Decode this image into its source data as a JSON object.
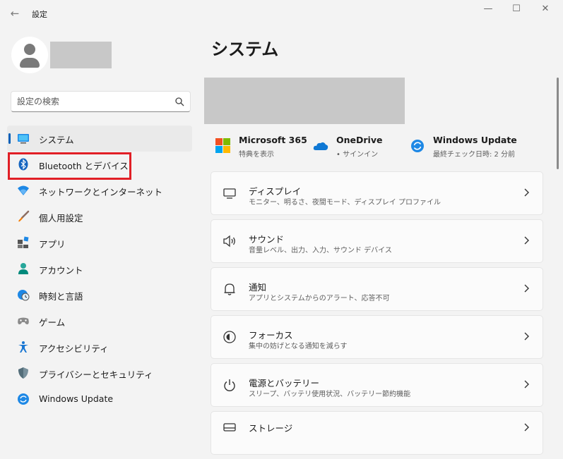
{
  "app": {
    "title": "設定"
  },
  "window_controls": {
    "minimize": "—",
    "maximize": "☐",
    "close": "✕"
  },
  "search": {
    "placeholder": "設定の検索"
  },
  "sidebar": {
    "items": [
      {
        "label": "システム",
        "icon": "display-icon"
      },
      {
        "label": "Bluetooth とデバイス",
        "icon": "bluetooth-icon"
      },
      {
        "label": "ネットワークとインターネット",
        "icon": "wifi-icon"
      },
      {
        "label": "個人用設定",
        "icon": "brush-icon"
      },
      {
        "label": "アプリ",
        "icon": "apps-icon"
      },
      {
        "label": "アカウント",
        "icon": "account-icon"
      },
      {
        "label": "時刻と言語",
        "icon": "globe-clock-icon"
      },
      {
        "label": "ゲーム",
        "icon": "gamepad-icon"
      },
      {
        "label": "アクセシビリティ",
        "icon": "accessibility-icon"
      },
      {
        "label": "プライバシーとセキュリティ",
        "icon": "shield-icon"
      },
      {
        "label": "Windows Update",
        "icon": "windows-update-icon"
      }
    ]
  },
  "main": {
    "title": "システム",
    "quick": [
      {
        "name": "Microsoft 365",
        "sub": "特典を表示",
        "icon": "microsoft-logo-icon"
      },
      {
        "name": "OneDrive",
        "sub": "• サインイン",
        "icon": "onedrive-cloud-icon"
      },
      {
        "name": "Windows Update",
        "sub": "最終チェック日時: 2 分前",
        "icon": "windows-update-icon"
      }
    ],
    "cards": [
      {
        "title": "ディスプレイ",
        "sub": "モニター、明るさ、夜間モード、ディスプレイ プロファイル",
        "icon": "monitor-icon"
      },
      {
        "title": "サウンド",
        "sub": "音量レベル、出力、入力、サウンド デバイス",
        "icon": "speaker-icon"
      },
      {
        "title": "通知",
        "sub": "アプリとシステムからのアラート、応答不可",
        "icon": "bell-icon"
      },
      {
        "title": "フォーカス",
        "sub": "集中の妨げとなる通知を減らす",
        "icon": "focus-icon"
      },
      {
        "title": "電源とバッテリー",
        "sub": "スリープ、バッテリ使用状況、バッテリー節約機能",
        "icon": "power-icon"
      },
      {
        "title": "ストレージ",
        "sub": "",
        "icon": "storage-icon"
      }
    ]
  },
  "colors": {
    "accent": "#005fb8",
    "highlight": "#e11f26",
    "background": "#f3f3f3"
  }
}
